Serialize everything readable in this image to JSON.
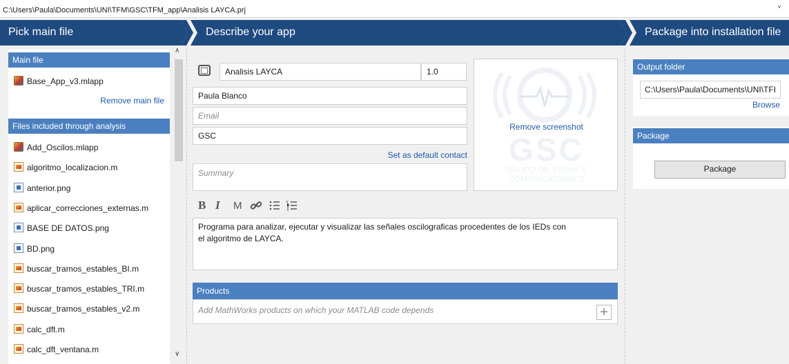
{
  "window": {
    "project_path": "C:\\Users\\Paula\\Documents\\UNI\\TFM\\GSC\\TFM_app\\Analisis LAYCA.prj"
  },
  "steps": {
    "pick": "Pick main file",
    "describe": "Describe your app",
    "package": "Package into installation file"
  },
  "main_file": {
    "header": "Main file",
    "file": "Base_App_v3.mlapp",
    "remove_label": "Remove main file"
  },
  "analysis": {
    "header": "Files included through analysis",
    "files": [
      {
        "name": "Add_Oscilos.mlapp",
        "icon": "mlapp-icon"
      },
      {
        "name": "algoritmo_localizacion.m",
        "icon": "m-file-icon"
      },
      {
        "name": "anterior.png",
        "icon": "png-file-icon"
      },
      {
        "name": "aplicar_correcciones_externas.m",
        "icon": "m-file-icon"
      },
      {
        "name": "BASE DE DATOS.png",
        "icon": "png-file-icon"
      },
      {
        "name": "BD.png",
        "icon": "png-file-icon"
      },
      {
        "name": "buscar_tramos_estables_BI.m",
        "icon": "m-file-icon"
      },
      {
        "name": "buscar_tramos_estables_TRI.m",
        "icon": "m-file-icon"
      },
      {
        "name": "buscar_tramos_estables_v2.m",
        "icon": "m-file-icon"
      },
      {
        "name": "calc_dft.m",
        "icon": "m-file-icon"
      },
      {
        "name": "calc_dft_ventana.m",
        "icon": "m-file-icon"
      }
    ]
  },
  "describe": {
    "app_name": "Analisis LAYCA",
    "version": "1.0",
    "author": "Paula Blanco",
    "email_placeholder": "Email",
    "organization": "GSC",
    "set_default_contact": "Set as default contact",
    "summary_placeholder": "Summary",
    "format_buttons": [
      "B",
      "I",
      "M"
    ],
    "description": "Programa para analizar, ejecutar y visualizar las señales oscilograficas procedentes de los IEDs con el algoritmo de LAYCA.",
    "remove_screenshot": "Remove screenshot",
    "logo": {
      "line1": "GSC",
      "line2": "GRUPO DE SEÑAL Y",
      "line3": "COMUNICACIONES"
    }
  },
  "products": {
    "header": "Products",
    "placeholder": "Add MathWorks products on which your MATLAB code depends",
    "add_icon": "plus-icon"
  },
  "output": {
    "header": "Output folder",
    "path": "C:\\Users\\Paula\\Documents\\UNI\\TFI",
    "browse": "Browse"
  },
  "package": {
    "header": "Package",
    "button": "Package"
  },
  "colors": {
    "step_bar": "#1e4a80",
    "panel_header": "#4b80c0",
    "link": "#1e5aa8"
  }
}
